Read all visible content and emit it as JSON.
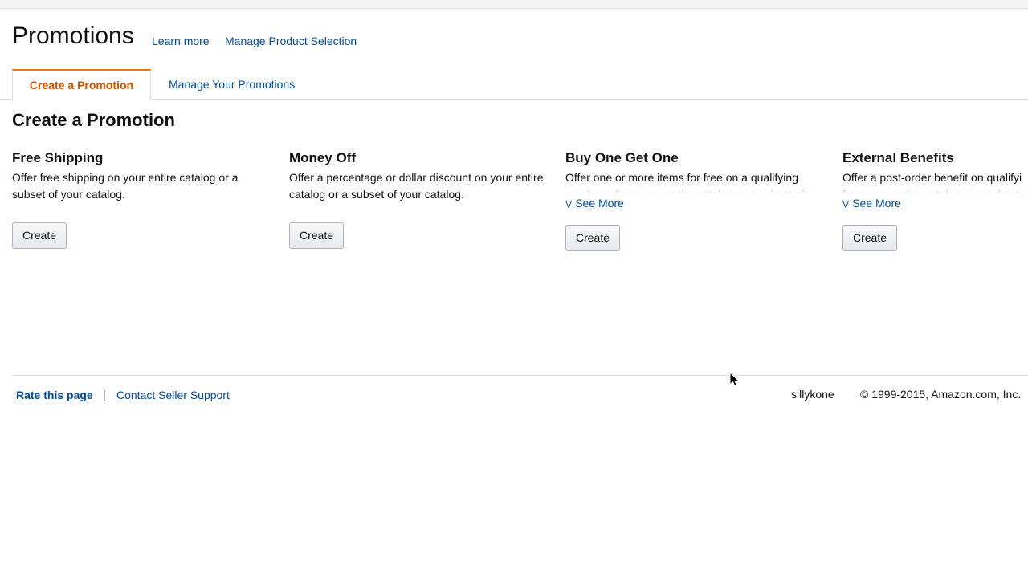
{
  "header": {
    "title": "Promotions",
    "links": [
      "Learn more",
      "Manage Product Selection"
    ]
  },
  "tabs": [
    {
      "label": "Create a Promotion",
      "active": true
    },
    {
      "label": "Manage Your Promotions",
      "active": false
    }
  ],
  "section_title": "Create a Promotion",
  "cards": [
    {
      "title": "Free Shipping",
      "description": "Offer free shipping on your entire catalog or a subset of your catalog.",
      "button": "Create"
    },
    {
      "title": "Money Off",
      "description": "Offer a percentage or dollar discount on your entire catalog or a subset of your catalog.",
      "button": "Create"
    },
    {
      "title": "Buy One Get One",
      "description": "Offer one or more items for free on a qualifying purchase from your entire catalog or a subset of",
      "see_more": "See More",
      "button": "Create"
    },
    {
      "title": "External Benefits",
      "description": "Offer a post-order benefit on qualifying from your entire catalog or a subset of",
      "see_more": "See More",
      "button": "Create"
    }
  ],
  "footer": {
    "rate": "Rate this page",
    "separator": "|",
    "support": "Contact Seller Support",
    "user": "sillykone",
    "copyright": "© 1999-2015, Amazon.com, Inc."
  },
  "colors": {
    "link": "#004b91",
    "active_tab": "#c45500",
    "tab_accent": "#e47911"
  }
}
